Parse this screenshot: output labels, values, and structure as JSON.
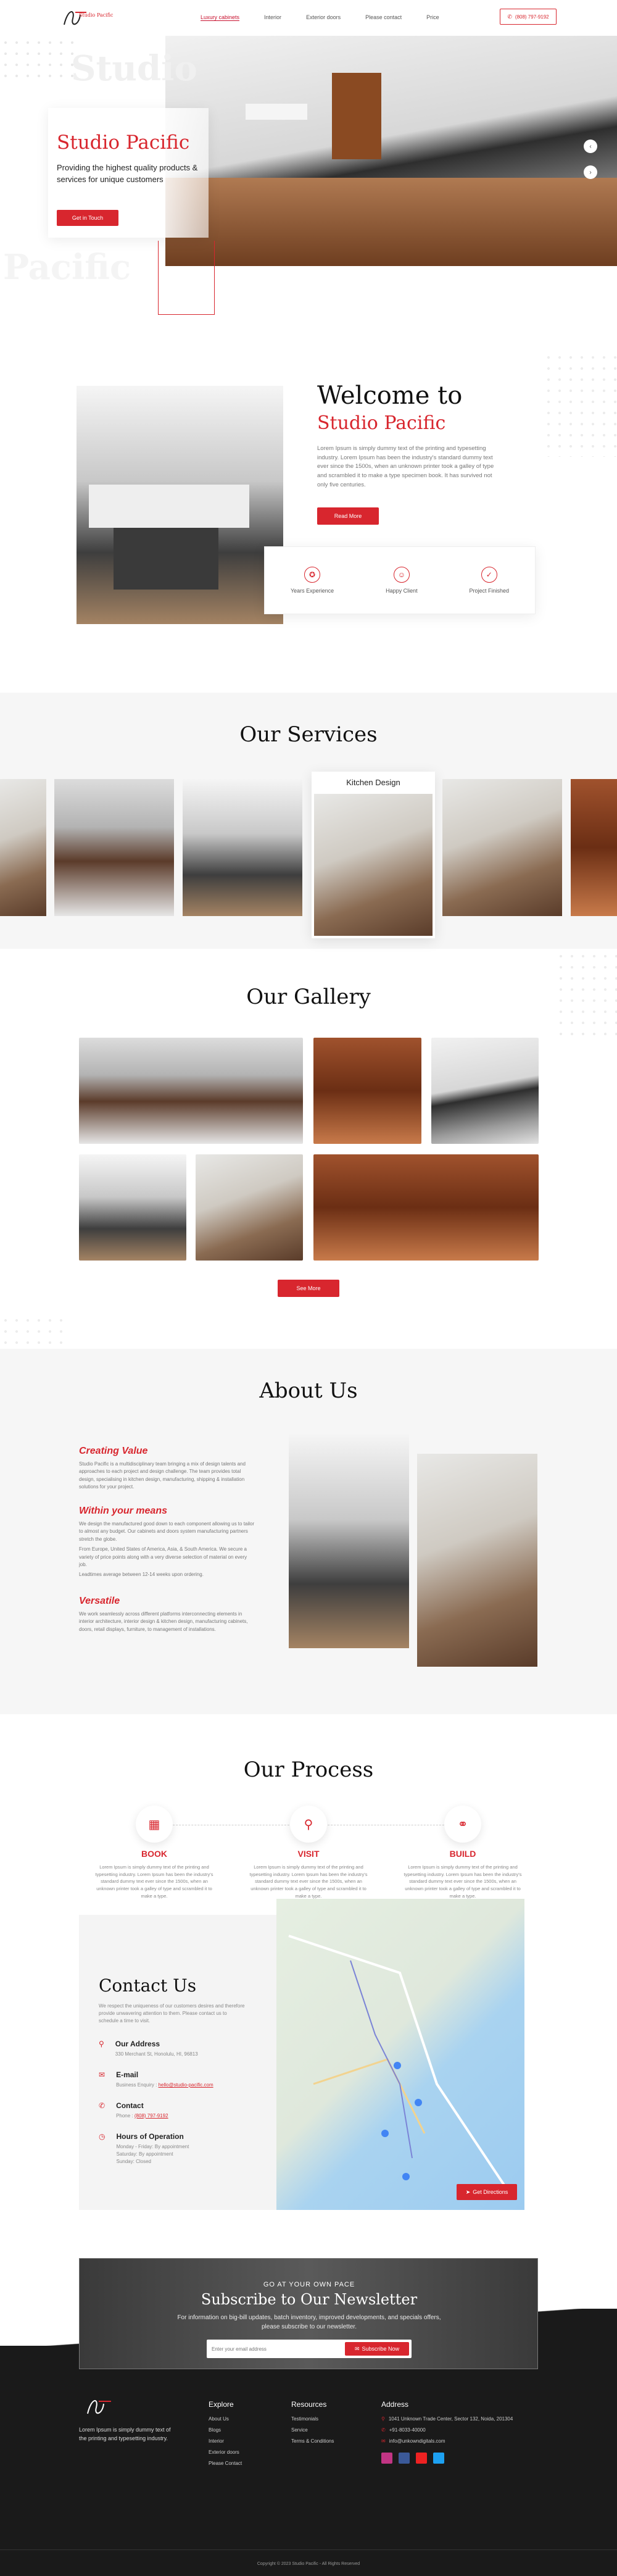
{
  "nav": {
    "logo_text": "Studio Pacific",
    "items": [
      "Luxury cabinets",
      "Interior",
      "Exterior doors",
      "Please contact",
      "Price"
    ],
    "phone": "(808) 797-9192"
  },
  "hero": {
    "bg_text_1": "Studio",
    "bg_text_2": "Pacific",
    "title": "Studio Pacific",
    "subtitle": "Providing the highest quality products & services for unique customers",
    "button": "Get in Touch"
  },
  "welcome": {
    "title_1": "Welcome to",
    "title_2": "Studio Pacific",
    "body": "Lorem Ipsum is simply dummy text of the printing and typesetting industry. Lorem Ipsum has been the industry's standard dummy text ever since the 1500s, when an unknown printer took a galley of type and scrambled it to make a type specimen book. It has survived not only five centuries.",
    "button": "Read More",
    "stats": [
      {
        "icon": "badge-icon",
        "label": "Years Experience"
      },
      {
        "icon": "smile-icon",
        "label": "Happy Client"
      },
      {
        "icon": "check-circle-icon",
        "label": "Project Finished"
      }
    ]
  },
  "services": {
    "title": "Our Services",
    "featured_label": "Kitchen Design"
  },
  "gallery": {
    "title": "Our Gallery",
    "button": "See More"
  },
  "about": {
    "title": "About Us",
    "blocks": [
      {
        "heading": "Creating Value",
        "text": "Studio Pacific is a multidisciplinary team bringing a mix of design talents and approaches to each project and design challenge. The team provides total design, specialising in kitchen design, manufacturing, shipping & installation solutions for your project."
      },
      {
        "heading": "Within your means",
        "text": "We design the manufactured good down to each component allowing us to tailor to almost any budget. Our cabinets and doors system manufacturing partners stretch the globe.",
        "text2": "From Europe, United States of America, Asia, & South America. We secure a variety of price points along with a very diverse selection of material on every job.",
        "text3": "Leadtimes average between 12-14 weeks upon ordering."
      },
      {
        "heading": "Versatile",
        "text": "We work seamlessly across different platforms interconnecting elements in interior architecture, interior design & kitchen design, manufacturing cabinets, doors, retail displays, furniture, to management of installations."
      }
    ]
  },
  "process": {
    "title": "Our Process",
    "steps": [
      {
        "icon": "calendar-icon",
        "label": "BOOK",
        "text": "Lorem Ipsum is simply dummy text of the printing and typesetting industry. Lorem Ipsum has been the industry's standard dummy text ever since the 1500s, when an unknown printer took a galley of type and scrambled it to make a type."
      },
      {
        "icon": "map-pin-icon",
        "label": "VISIT",
        "text": "Lorem Ipsum is simply dummy text of the printing and typesetting industry. Lorem Ipsum has been the industry's standard dummy text ever since the 1500s, when an unknown printer took a galley of type and scrambled it to make a type."
      },
      {
        "icon": "handshake-icon",
        "label": "BUILD",
        "text": "Lorem Ipsum is simply dummy text of the printing and typesetting industry. Lorem Ipsum has been the industry's standard dummy text ever since the 1500s, when an unknown printer took a galley of type and scrambled it to make a type."
      }
    ]
  },
  "contact": {
    "title": "Contact Us",
    "intro": "We respect the uniqueness of our customers desires and therefore provide unwavering attention to them. Please contact us to schedule a time to visit.",
    "address_label": "Our Address",
    "address": "330 Merchant St, Honolulu, HI, 96813",
    "email_label": "E-mail",
    "email_prefix": "Business Enquiry :",
    "email": "hello@studio-pacific.com",
    "contact_label": "Contact",
    "phone_prefix": "Phone :",
    "phone": "(808) 797-9192",
    "hours_label": "Hours of Operation",
    "hours": [
      "Monday - Friday: By appointment",
      "Saturday: By appointment",
      "Sunday: Closed"
    ],
    "map_button": "Get Directions"
  },
  "newsletter": {
    "kicker": "GO AT YOUR OWN PACE",
    "title": "Subscribe to Our Newsletter",
    "text": "For information on big-bill updates, batch inventory, improved developments, and specials offers, please subscribe to our newsletter.",
    "placeholder": "Enter your email address",
    "button": "Subscribe Now"
  },
  "footer": {
    "about": "Lorem Ipsum is simply dummy text of the printing and typesetting industry.",
    "explore_title": "Explore",
    "explore": [
      "About Us",
      "Blogs",
      "Interior",
      "Exterior doors",
      "Please Contact"
    ],
    "resources_title": "Resources",
    "resources": [
      "Testimonials",
      "Service",
      "Terms & Conditions"
    ],
    "address_title": "Address",
    "address": "1041 Unknown Trade Center, Sector 132, Noida, 201304",
    "phone": "+91-8033-40000",
    "email": "info@unkowndigitals.com",
    "copyright": "Copyright © 2023 Studio Pacific - All Rights Reserved"
  }
}
